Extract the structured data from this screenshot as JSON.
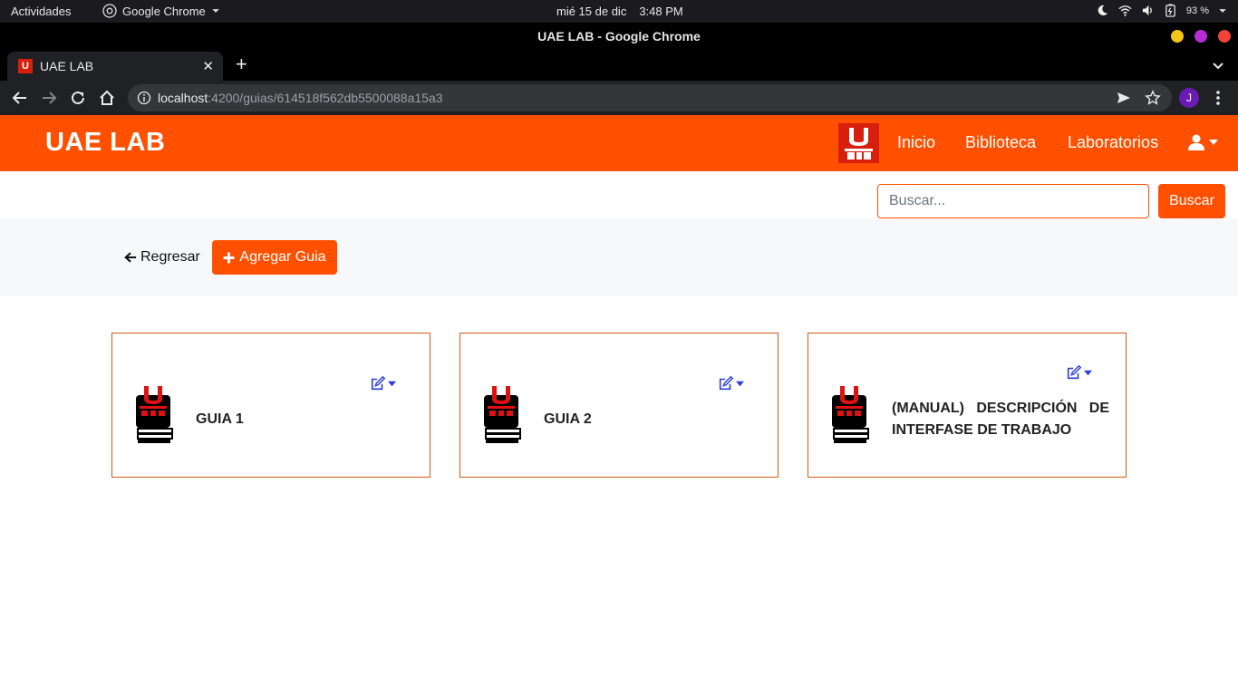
{
  "os_bar": {
    "activities": "Actividades",
    "app_name": "Google Chrome",
    "date": "mié 15 de dic",
    "time": "3:48 PM",
    "battery": "93 %"
  },
  "browser": {
    "window_title": "UAE LAB - Google Chrome",
    "tab_title": "UAE LAB",
    "url_host": "localhost",
    "url_path": ":4200/guias/614518f562db5500088a15a3",
    "profile_initial": "J"
  },
  "navbar": {
    "brand": "UAE LAB",
    "links": [
      "Inicio",
      "Biblioteca",
      "Laboratorios"
    ]
  },
  "search": {
    "placeholder": "Buscar...",
    "button": "Buscar"
  },
  "actions": {
    "back": "Regresar",
    "add": "Agregar Guia"
  },
  "guides": [
    {
      "title": "GUIA 1"
    },
    {
      "title": "GUIA 2"
    },
    {
      "title": "(MANUAL) DESCRIPCIÓN DE INTERFASE DE TRABAJO"
    }
  ],
  "colors": {
    "brand_orange": "#ff5000",
    "card_border": "#cf5a17",
    "edit_icon": "#2b3fd6"
  }
}
